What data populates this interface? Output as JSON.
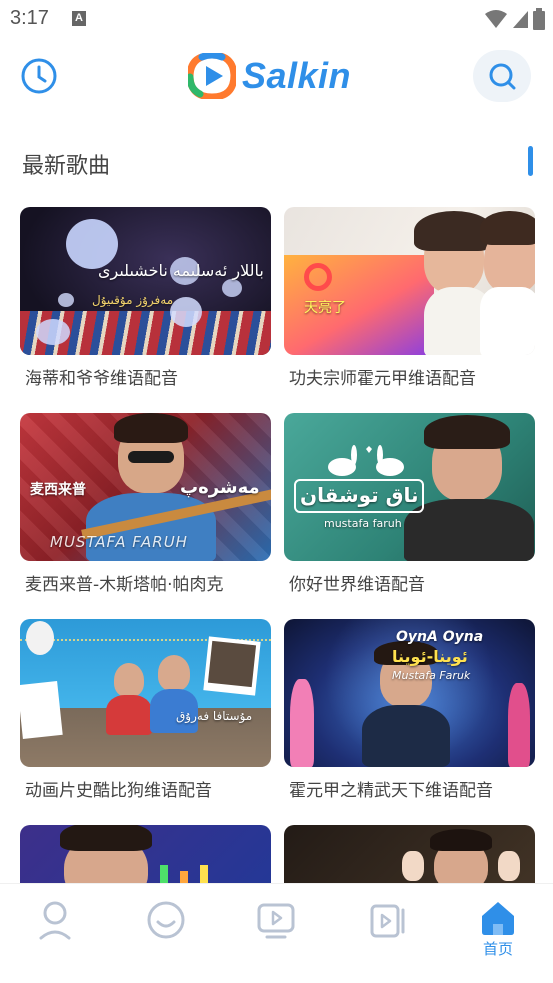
{
  "status": {
    "time": "3:17",
    "notification_glyph": "A"
  },
  "header": {
    "logo_text": "Salkin",
    "left_icon": "clock-icon",
    "right_icon": "search-icon"
  },
  "section": {
    "title": "最新歌曲"
  },
  "cards": [
    {
      "title": "海蒂和爷爷维语配音",
      "overlay": [
        "باللار ئەسلىمە ناخشىلىرى",
        "مەفرۇز مۇقىيۇل"
      ]
    },
    {
      "title": "功夫宗师霍元甲维语配音",
      "overlay": [
        "天亮了"
      ]
    },
    {
      "title": "麦西来普-木斯塔帕·帕肉克",
      "overlay": [
        "麦西来普",
        "مەشرەپ",
        "MUSTAFA FARUH"
      ]
    },
    {
      "title": "你好世界维语配音",
      "overlay": [
        "ناق توشقان",
        "mustafa faruh"
      ]
    },
    {
      "title": "动画片史酷比狗维语配音",
      "overlay": [
        "مۇستافا فەرۇق"
      ]
    },
    {
      "title": "霍元甲之精武天下维语配音",
      "overlay": [
        "OynA Oyna",
        "ئوينا-ئوينا",
        "Mustafa Faruk"
      ]
    },
    {
      "title": "",
      "overlay": []
    },
    {
      "title": "",
      "overlay": []
    }
  ],
  "bottom_nav": [
    {
      "icon": "person-icon",
      "label": ""
    },
    {
      "icon": "smile-icon",
      "label": ""
    },
    {
      "icon": "video-play-icon",
      "label": ""
    },
    {
      "icon": "video-library-icon",
      "label": ""
    },
    {
      "icon": "home-icon",
      "label": "首页",
      "active": true
    }
  ],
  "colors": {
    "accent": "#2f8fe8",
    "nav_inactive": "#b9c3d3"
  }
}
